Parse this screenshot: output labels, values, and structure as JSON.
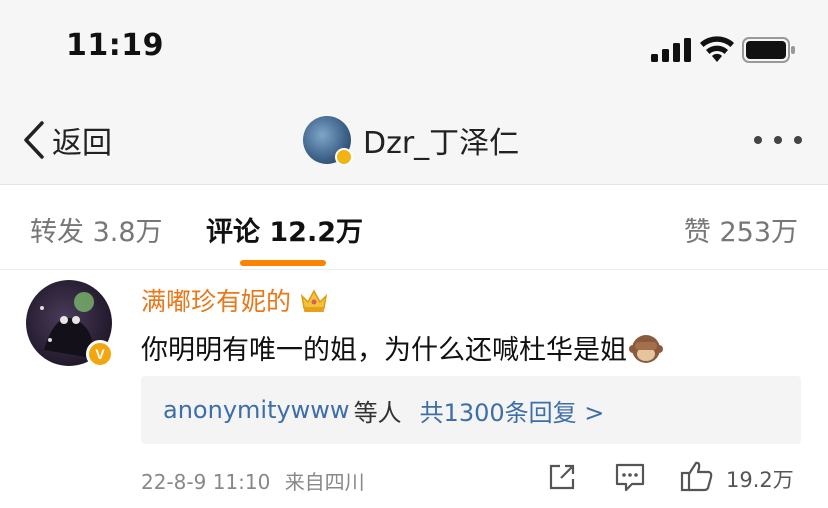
{
  "status_bar": {
    "time": "11:19"
  },
  "nav": {
    "back_label": "返回",
    "title": "Dzr_丁泽仁"
  },
  "tabs": [
    {
      "label": "转发 3.8万"
    },
    {
      "label": "评论 12.2万"
    },
    {
      "label": "赞 253万"
    }
  ],
  "active_tab": "评论 12.2万",
  "comment": {
    "username": "满嘟珍有妮的",
    "text": "你明明有唯一的姐，为什么还喊杜华是姐",
    "replies_user": "anonymitywww",
    "replies_suffix": "等人",
    "replies_count": "共1300条回复 >",
    "timestamp": "22-8-9 11:10",
    "source": "来自四川",
    "like_count": "19.2万"
  },
  "colors": {
    "accent_orange": "#ff8200",
    "username": "#e8781a",
    "link_blue": "#3d6ea8"
  }
}
